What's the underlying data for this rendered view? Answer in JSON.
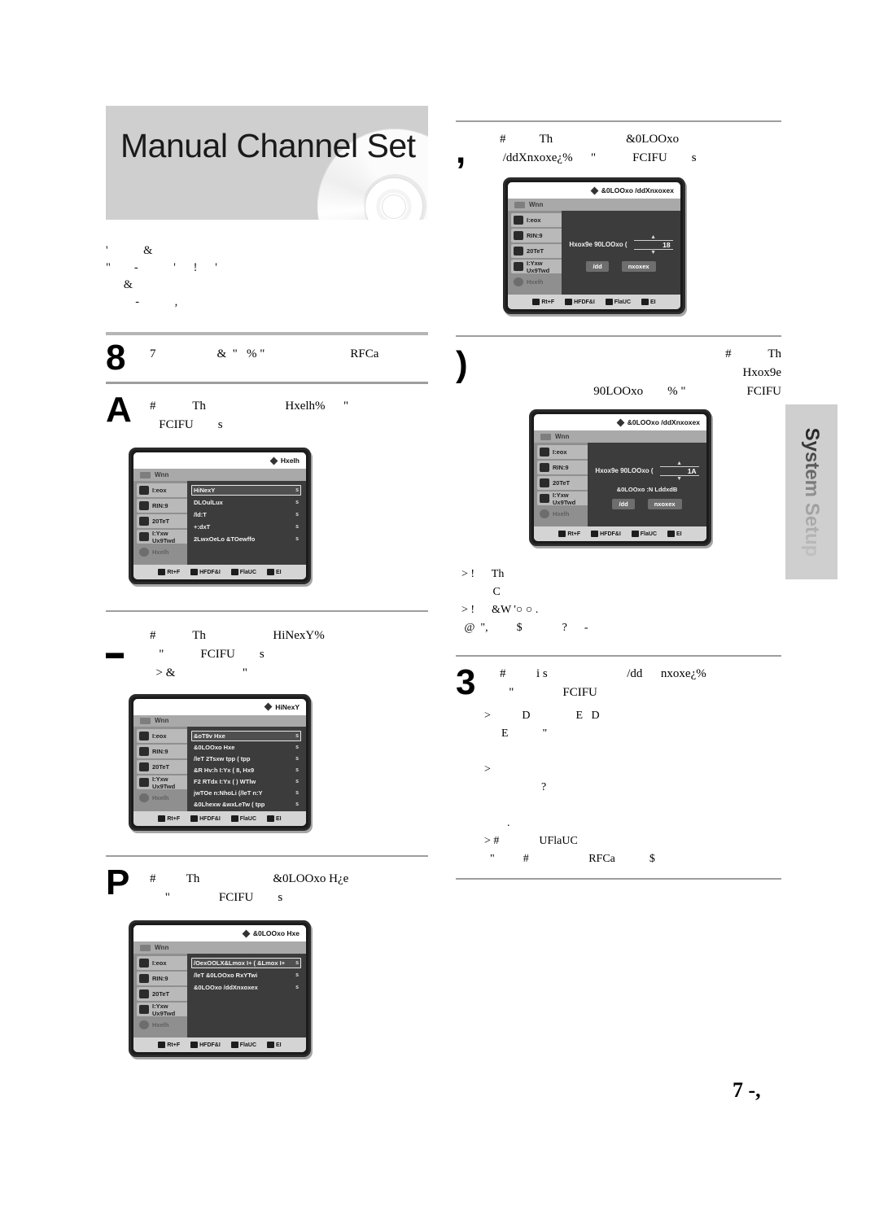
{
  "page": {
    "title": "Manual Channel Set",
    "side_tab_label": "System Setup",
    "folio": "7 -,"
  },
  "intro": {
    "lines": "'            &\n\"        -            '      !      '\n      &\n          -            ,"
  },
  "steps": [
    {
      "number": "8",
      "text": "7                    &  \"   % \"                            RFCa"
    },
    {
      "number": "A",
      "text": "#            Th                          Hxelh%      \"\n   FCIFU        s"
    },
    {
      "number": "▬",
      "text": "#            Th                      HiNexY%\n   \"            FCIFU        s\n  > &                      \""
    },
    {
      "number": "P",
      "text": "#          Th                        &0LOOxo H¿e\n     \"                FCIFU        s"
    },
    {
      "number": ",",
      "text": "#           Th                        &0LOOxo\n /ddXnxoxe¿%      \"            FCIFU        s"
    },
    {
      "number": ")",
      "text": "#            Th\n                                                   Hxox9e\n 90LOOxo        % \"                    FCIFU"
    },
    {
      "number": "3",
      "text": "#          i s                          /dd      nxoxe¿%\n   \"                FCIFU"
    }
  ],
  "notes": {
    "after_step_6": "  > !      Th\n             C\n  > !      &W '○ ○ .\n   @  \",          $              ?      -",
    "after_step_7": "  >           D                E   D\n        E            \"\n\n  >\n                      ?\n\n          .\n  > #              UFlaUC\n    \"          #                     RFCa            $"
  },
  "osd_common": {
    "diamond_icon": "diamond-icon",
    "subbar_label": "Wnn",
    "sidebar_items": [
      {
        "label": "I:eox",
        "icon": "film-icon"
      },
      {
        "label": "RIN:9",
        "icon": "music-note-icon"
      },
      {
        "label": "20TeT",
        "icon": "picture-icon"
      },
      {
        "label": "I:Yxw Ux9Twd",
        "icon": "globe-icon"
      }
    ],
    "sidebar_footer": {
      "label": "Hxelh",
      "icon": "gear-icon"
    },
    "footer_items": [
      {
        "icon": "dpad-icon",
        "label": "Rt+F"
      },
      {
        "icon": "enter-icon",
        "label": "HFDF&I"
      },
      {
        "icon": "return-icon",
        "label": "FlaUC"
      },
      {
        "icon": "exit-icon",
        "label": "EI"
      }
    ]
  },
  "osd_panels": {
    "setup": {
      "title": "Hxelh",
      "rows": [
        {
          "label": "HiNexY",
          "value": "s",
          "selected": true
        },
        {
          "label": "DLOulLux",
          "value": "s",
          "selected": false
        },
        {
          "label": "/ld:T",
          "value": "s",
          "selected": false
        },
        {
          "label": "+:dxT",
          "value": "s",
          "selected": false
        },
        {
          "label": "2LwxOeLo &TOewffo",
          "value": "s",
          "selected": false
        }
      ]
    },
    "language": {
      "title": "HiNexY",
      "rows": [
        {
          "label": "&oT9v Hxe",
          "value": "s",
          "selected": true
        },
        {
          "label": "&0LOOxo Hxe",
          "value": "s",
          "selected": false
        },
        {
          "label": "/leT 2Tsxw tpp   ( tpp",
          "value": "s",
          "selected": false
        },
        {
          "label": "&R Hv:h I:Yx    ( 8, Hx9",
          "value": "s",
          "selected": false
        },
        {
          "label": "F2 RTdx I:Yx    ( ) WTlw",
          "value": "s",
          "selected": false
        },
        {
          "label": "jwTOe n:NhoLi      (/leT n:Y",
          "value": "s",
          "selected": false
        },
        {
          "label": "&0Lhexw &wxLeTw  ( tpp",
          "value": "s",
          "selected": false
        }
      ]
    },
    "channel_set": {
      "title": "&0LOOxo Hxe",
      "rows": [
        {
          "label": "/OexOOLX&Lmox I+    ( &Lmox I+",
          "value": "s",
          "selected": true
        },
        {
          "label": "/leT &0LOOxo RxYTwi",
          "value": "s",
          "selected": false
        },
        {
          "label": "&0LOOxo /ddXnxoxex",
          "value": "s",
          "selected": false
        }
      ]
    },
    "add_channel_1": {
      "title": "&0LOOxo /ddXnxoxex",
      "stepper_label": "Hxox9e 90LOOxo (",
      "stepper_value": "18",
      "sub_label": "",
      "buttons": [
        "/dd",
        "nxoxex"
      ]
    },
    "add_channel_2": {
      "title": "&0LOOxo /ddXnxoxex",
      "stepper_label": "Hxox9e 90LOOxo (",
      "stepper_value": "1A",
      "sub_label": "&0LOOxo :N LddxdB",
      "buttons": [
        "/dd",
        "nxoxex"
      ]
    }
  }
}
